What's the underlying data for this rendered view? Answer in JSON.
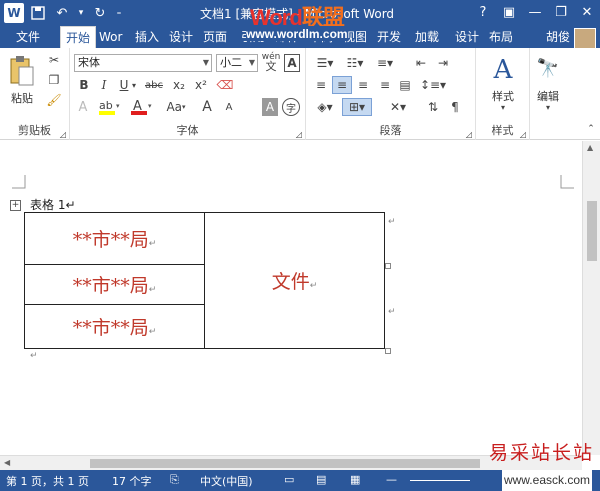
{
  "titlebar": {
    "doc_title": "文档1 [兼容模式] - Microsoft Word",
    "watermark_a": "Word",
    "watermark_b": "联盟",
    "help": "?",
    "minimize": "—",
    "restore": "❐",
    "close": "✕"
  },
  "tabs": {
    "file": "文件",
    "home": "开始",
    "wor": "Wor",
    "insert": "插入",
    "design": "设计",
    "layout": "页面",
    "refs": "引用",
    "mail": "邮件",
    "review": "审阅",
    "view": "视图",
    "dev": "开发",
    "addin": "加载",
    "tdesign": "设计",
    "tlayout": "布局",
    "url": "www.wordlm.com",
    "user": "胡俊"
  },
  "ribbon": {
    "paste_label": "粘贴",
    "clipboard_label": "剪贴板",
    "font_name": "宋体",
    "font_size": "小二",
    "font_label": "字体",
    "paragraph_label": "段落",
    "styles_button": "样式",
    "styles_label": "样式",
    "edit_button": "编辑",
    "bold": "B",
    "italic": "I",
    "underline": "U",
    "strike": "abc",
    "sub": "x₂",
    "sup": "x²",
    "grow": "A",
    "shrink": "A",
    "aa": "Aa",
    "pinyin": "wén",
    "char_a": "A"
  },
  "document": {
    "caption": "表格 1↵",
    "move_handle": "+",
    "cells": {
      "row1": "**市**局",
      "row2": "**市**局",
      "row3": "**市**局",
      "right": "文件"
    },
    "end_mark": "↵"
  },
  "status": {
    "page": "第 1 页，共 1 页",
    "words": "17 个字",
    "lang": "中文(中国)"
  },
  "watermark": {
    "site_name": "易采站长站",
    "site_url": "www.easck.com"
  },
  "colors": {
    "accent": "#2b579a",
    "cell_text": "#c0392b"
  }
}
